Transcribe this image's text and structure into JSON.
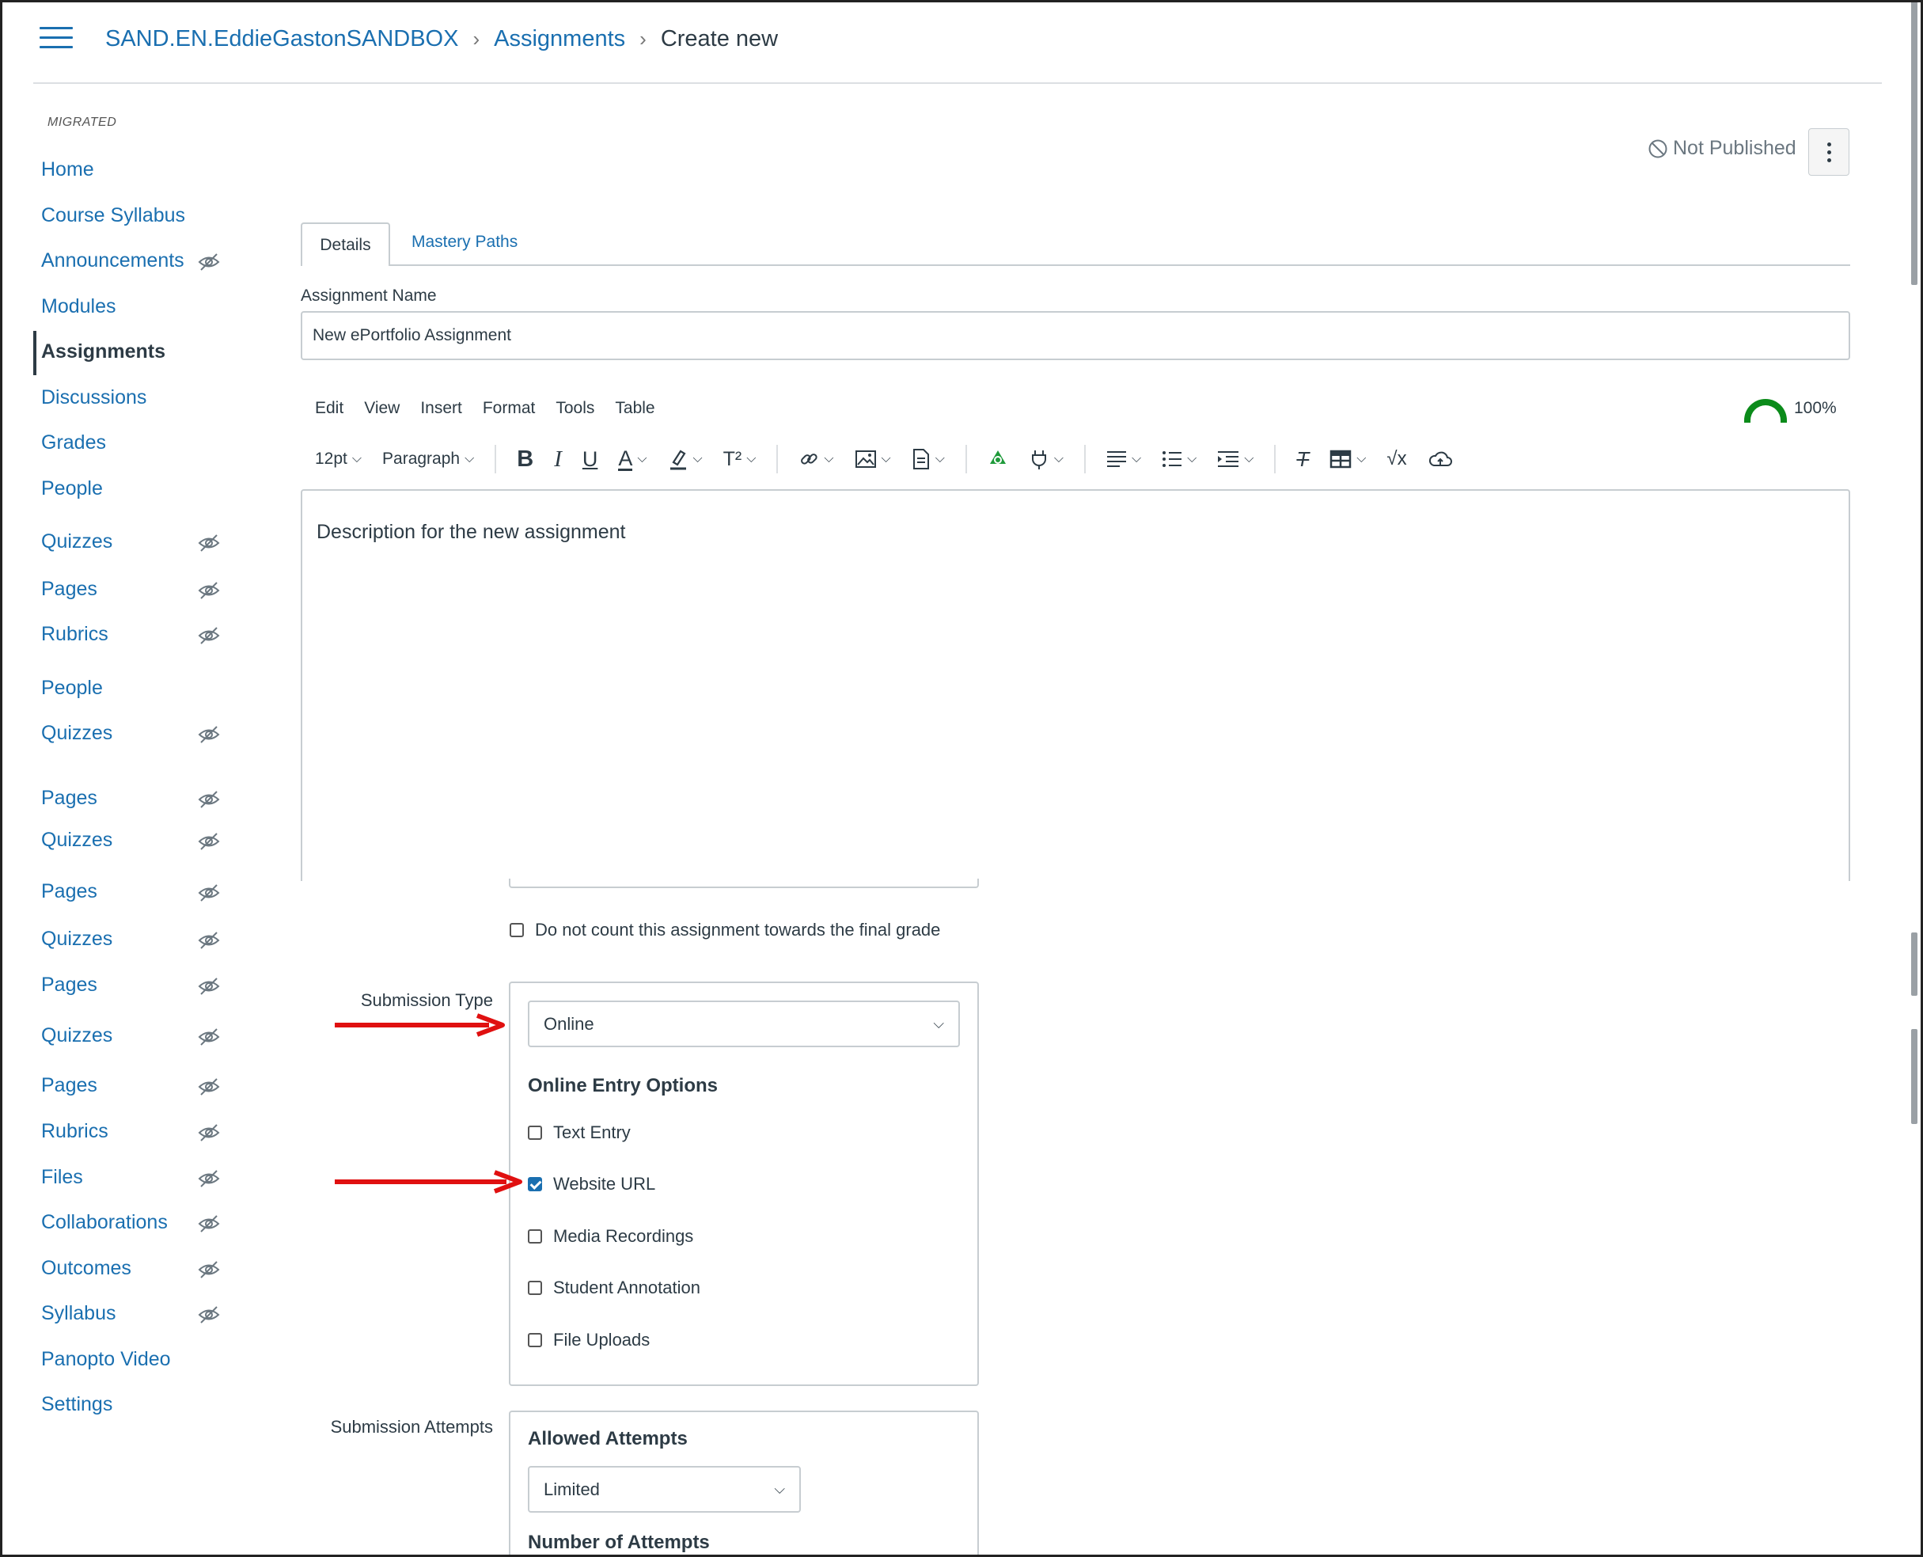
{
  "breadcrumb": {
    "course": "SAND.EN.EddieGastonSANDBOX",
    "section": "Assignments",
    "current": "Create new"
  },
  "sidebar": {
    "migrated_label": "MIGRATED",
    "items": [
      {
        "label": "Home"
      },
      {
        "label": "Course Syllabus"
      },
      {
        "label": "Announcements"
      },
      {
        "label": "Modules"
      },
      {
        "label": "Assignments"
      },
      {
        "label": "Discussions"
      },
      {
        "label": "Grades"
      },
      {
        "label": "People"
      },
      {
        "label": "Quizzes"
      },
      {
        "label": "Pages"
      },
      {
        "label": "Rubrics"
      },
      {
        "label": "People"
      },
      {
        "label": "Quizzes"
      },
      {
        "label": "Pages"
      },
      {
        "label": "Quizzes"
      },
      {
        "label": "Pages"
      },
      {
        "label": "Quizzes"
      },
      {
        "label": "Pages"
      },
      {
        "label": "Quizzes"
      },
      {
        "label": "Pages"
      },
      {
        "label": "Rubrics"
      },
      {
        "label": "Files"
      },
      {
        "label": "Collaborations"
      },
      {
        "label": "Outcomes"
      },
      {
        "label": "Syllabus"
      },
      {
        "label": "Panopto Video"
      },
      {
        "label": "Settings"
      }
    ]
  },
  "status": {
    "publish_label": "Not Published"
  },
  "tabs": {
    "details": "Details",
    "mastery_paths": "Mastery Paths"
  },
  "assignment_name": {
    "label": "Assignment Name",
    "value": "New ePortfolio Assignment"
  },
  "editor": {
    "menus": [
      "Edit",
      "View",
      "Insert",
      "Format",
      "Tools",
      "Table"
    ],
    "font_size": "12pt",
    "block_format": "Paragraph",
    "accessibility_score": "100%",
    "content": "Description for the new assignment"
  },
  "grading": {
    "exclude_label": "Do not count this assignment towards the final grade"
  },
  "submission": {
    "type_label": "Submission Type",
    "type_value": "Online",
    "entry_options_title": "Online Entry Options",
    "options": [
      {
        "label": "Text Entry",
        "checked": false
      },
      {
        "label": "Website URL",
        "checked": true
      },
      {
        "label": "Media Recordings",
        "checked": false
      },
      {
        "label": "Student Annotation",
        "checked": false
      },
      {
        "label": "File Uploads",
        "checked": false
      }
    ]
  },
  "attempts": {
    "label": "Submission Attempts",
    "allowed_title": "Allowed Attempts",
    "allowed_value": "Limited",
    "number_title": "Number of Attempts"
  },
  "colors": {
    "link": "#1a6fb0",
    "accent_arrow": "#e01010",
    "success": "#0b8b1a"
  }
}
